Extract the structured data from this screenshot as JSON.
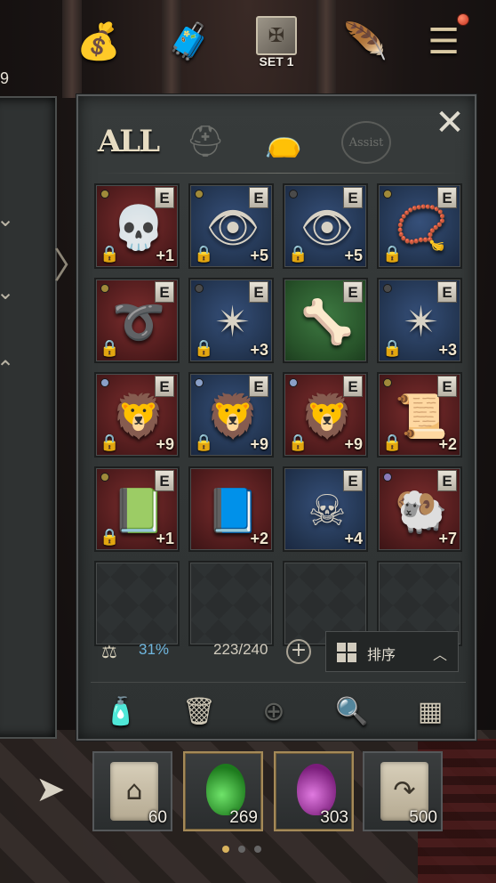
{
  "topbar": {
    "left_edge_number": "9",
    "icons": [
      {
        "name": "gold-bag-icon",
        "glyph": "💰"
      },
      {
        "name": "trade-chest-icon",
        "glyph": "🧳"
      },
      {
        "name": "equipment-set-icon",
        "glyph": "✠"
      },
      {
        "name": "quill-mail-icon",
        "glyph": "🪶"
      },
      {
        "name": "main-menu-icon",
        "glyph": "☰"
      }
    ],
    "set_label": "SET 1"
  },
  "tabs": {
    "all_label": "ALL",
    "assist_label": "Assist",
    "armor_glyph": "⛑",
    "bag_glyph": "👝",
    "close_glyph": "✕"
  },
  "inventory": {
    "badge_label": "E",
    "lock_glyph": "🔒",
    "slots": [
      {
        "art": "💀",
        "bg": "red",
        "grade_color": "#a08a3a",
        "locked": true,
        "equipped": true,
        "enhance": "+1"
      },
      {
        "art": "👁",
        "bg": "blue",
        "grade_color": "#a08a3a",
        "locked": true,
        "equipped": true,
        "enhance": "+5"
      },
      {
        "art": "👁",
        "bg": "blue",
        "grade_color": "#4a4a4a",
        "locked": true,
        "equipped": true,
        "enhance": "+5"
      },
      {
        "art": "📿",
        "bg": "blue",
        "grade_color": "#a08a3a",
        "locked": true,
        "equipped": true,
        "enhance": ""
      },
      {
        "art": "➰",
        "bg": "red",
        "grade_color": "#a08a3a",
        "locked": true,
        "equipped": true,
        "enhance": ""
      },
      {
        "art": "✴",
        "bg": "blue",
        "grade_color": "#4a4a4a",
        "locked": true,
        "equipped": true,
        "enhance": "+3"
      },
      {
        "art": "🦴",
        "bg": "green",
        "grade_color": "",
        "locked": false,
        "equipped": true,
        "enhance": ""
      },
      {
        "art": "✴",
        "bg": "blue",
        "grade_color": "#4a4a4a",
        "locked": true,
        "equipped": true,
        "enhance": "+3"
      },
      {
        "art": "🦁",
        "bg": "red",
        "grade_color": "#8aa0c8",
        "locked": true,
        "equipped": true,
        "enhance": "+9"
      },
      {
        "art": "🦁",
        "bg": "blue",
        "grade_color": "#8aa0c8",
        "locked": true,
        "equipped": true,
        "enhance": "+9"
      },
      {
        "art": "🦁",
        "bg": "red",
        "grade_color": "#8aa0c8",
        "locked": true,
        "equipped": true,
        "enhance": "+9"
      },
      {
        "art": "📜",
        "bg": "red",
        "grade_color": "#a08a3a",
        "locked": true,
        "equipped": true,
        "enhance": "+2"
      },
      {
        "art": "📗",
        "bg": "red",
        "grade_color": "#a08a3a",
        "locked": true,
        "equipped": true,
        "enhance": "+1"
      },
      {
        "art": "📘",
        "bg": "red",
        "grade_color": "",
        "locked": false,
        "equipped": false,
        "enhance": "+2"
      },
      {
        "art": "☠",
        "bg": "blue",
        "grade_color": "",
        "locked": false,
        "equipped": true,
        "enhance": "+4"
      },
      {
        "art": "🐏",
        "bg": "red",
        "grade_color": "#8a7ab8",
        "locked": false,
        "equipped": true,
        "enhance": "+7"
      }
    ],
    "empty_slot_count": 4
  },
  "footer": {
    "weight_percent": "31%",
    "slot_count": "223/240",
    "expand_glyph": "+",
    "sort_label": "排序",
    "sort_caret": "︿",
    "tools": [
      {
        "name": "potion-bottle-icon",
        "glyph": "🧴",
        "dim": false
      },
      {
        "name": "trash-can-icon",
        "glyph": "🗑",
        "dim": false
      },
      {
        "name": "zoom-in-icon",
        "glyph": "⊕",
        "dim": true
      },
      {
        "name": "search-icon",
        "glyph": "🔍",
        "dim": false
      },
      {
        "name": "grid-view-icon",
        "glyph": "▦",
        "dim": false
      }
    ]
  },
  "quickbar": {
    "arrow_glyph": "➤",
    "slots": [
      {
        "name": "return-scroll",
        "count": "60"
      },
      {
        "name": "green-potion",
        "count": "269"
      },
      {
        "name": "purple-potion",
        "count": "303"
      },
      {
        "name": "teleport-scroll",
        "count": "500"
      }
    ]
  },
  "left_panel": {
    "arrows": [
      "⌄",
      "⌄",
      "⌃"
    ],
    "side_arrow": "〉"
  },
  "colors": {
    "accent_gold": "#d9b35e",
    "weight_blue": "#6fb6de"
  }
}
